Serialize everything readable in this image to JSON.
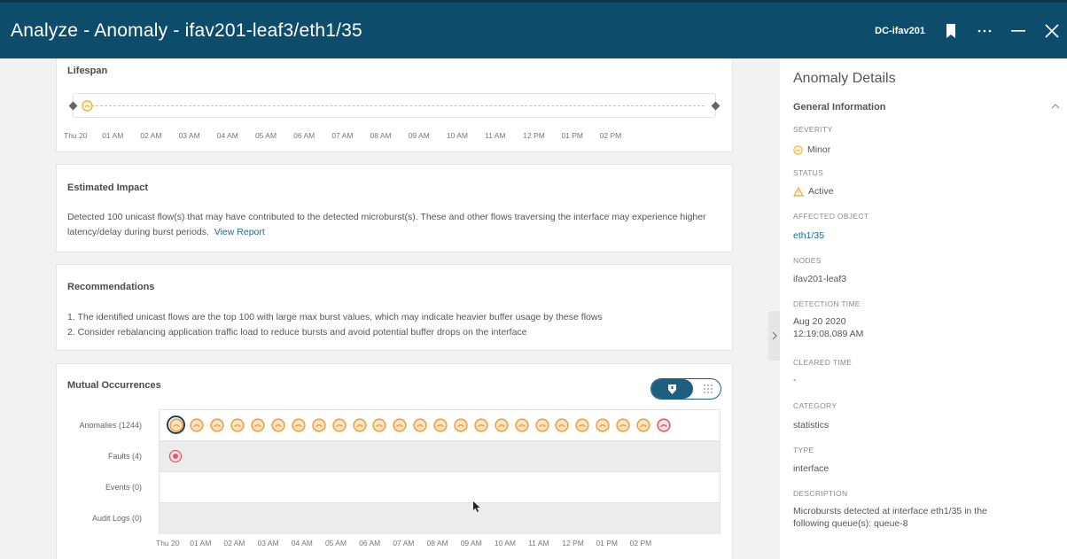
{
  "window": {
    "title": "Analyze - Anomaly - ifav201-leaf3/eth1/35",
    "site": "DC-ifav201"
  },
  "lifespan": {
    "title": "Lifespan",
    "ticks": [
      "Thu 20",
      "01 AM",
      "02 AM",
      "03 AM",
      "04 AM",
      "05 AM",
      "06 AM",
      "07 AM",
      "08 AM",
      "09 AM",
      "10 AM",
      "11 AM",
      "12 PM",
      "01 PM",
      "02 PM"
    ]
  },
  "impact": {
    "title": "Estimated Impact",
    "text": "Detected 100 unicast flow(s) that may have contributed to the detected microburst(s). These and other flows traversing the interface may experience higher latency/delay during burst periods.",
    "link": "View Report"
  },
  "recommendations": {
    "title": "Recommendations",
    "items": [
      "1. The identified unicast flows are the top 100 with large max burst values, which may indicate heavier buffer usage by these flows",
      "2. Consider rebalancing application traffic load to reduce bursts and avoid potential buffer drops on the interface"
    ]
  },
  "mutual": {
    "title": "Mutual Occurrences",
    "rows": [
      {
        "label": "Anomalies (1244)"
      },
      {
        "label": "Faults (4)"
      },
      {
        "label": "Events (0)"
      },
      {
        "label": "Audit Logs (0)"
      }
    ],
    "ticks": [
      "Thu 20",
      "01 AM",
      "02 AM",
      "03 AM",
      "04 AM",
      "05 AM",
      "06 AM",
      "07 AM",
      "08 AM",
      "09 AM",
      "10 AM",
      "11 AM",
      "12 PM",
      "01 PM",
      "02 PM"
    ]
  },
  "details": {
    "heading": "Anomaly Details",
    "section": "General Information",
    "fields": [
      {
        "label": "SEVERITY",
        "value": "Minor"
      },
      {
        "label": "STATUS",
        "value": "Active"
      },
      {
        "label": "AFFECTED OBJECT",
        "value": "eth1/35"
      },
      {
        "label": "NODES",
        "value": "ifav201-leaf3"
      },
      {
        "label": "DETECTION TIME",
        "value": "Aug 20 2020",
        "value2": "12:19:08.089 AM"
      },
      {
        "label": "CLEARED TIME",
        "value": "-"
      },
      {
        "label": "CATEGORY",
        "value": "statistics"
      },
      {
        "label": "TYPE",
        "value": "interface"
      },
      {
        "label": "DESCRIPTION",
        "value": "Microbursts detected at interface eth1/35 in the",
        "value2": "following queue(s): queue-8"
      }
    ]
  },
  "colors": {
    "titlebar": "#0d4d6b",
    "minor": "#f0a040",
    "major": "#e25a6a",
    "link": "#1b6c95"
  }
}
